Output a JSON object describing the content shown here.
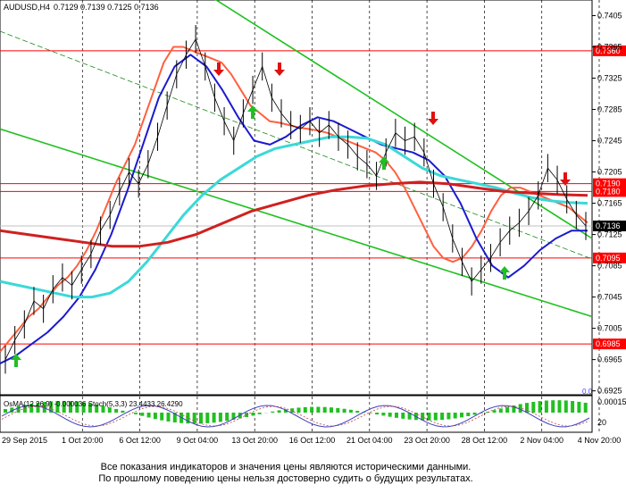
{
  "header": {
    "symbol": "AUDUSD,H4",
    "ohlc": "0.7129 0.7139 0.7125 0.7136"
  },
  "footer": {
    "line1": "Все показания индикаторов и значения цены являются историческими данными.",
    "line2": "По прошлому поведению цены нельзя достоверно судить о будущих результатах."
  },
  "chart_data": {
    "type": "line",
    "symbol": "AUDUSD",
    "timeframe": "H4",
    "ylim": [
      0.692,
      0.7425
    ],
    "y_ticks": [
      "0.7405",
      "0.7365",
      "0.7325",
      "0.7285",
      "0.7245",
      "0.7205",
      "0.7165",
      "0.7125",
      "0.7085",
      "0.7045",
      "0.7005",
      "0.6965",
      "0.6925"
    ],
    "x_ticks": [
      "29 Sep 2015",
      "1 Oct 20:00",
      "6 Oct 12:00",
      "9 Oct 04:00",
      "13 Oct 20:00",
      "16 Oct 12:00",
      "21 Oct 04:00",
      "23 Oct 20:00",
      "28 Oct 12:00",
      "2 Nov 04:00",
      "4 Nov 20:00"
    ],
    "levels": [
      {
        "label": "0.7360",
        "value": 0.736,
        "color": "#ff0000"
      },
      {
        "label": "0.7190",
        "value": 0.719,
        "color": "#ff0000"
      },
      {
        "label": "0.7180",
        "value": 0.718,
        "color": "#ff0000"
      },
      {
        "label": "0.7095",
        "value": 0.7095,
        "color": "#ff0000"
      },
      {
        "label": "0.6985",
        "value": 0.6985,
        "color": "#ff0000"
      }
    ],
    "current_price": {
      "label": "0.7136",
      "value": 0.7136
    },
    "price_series": [
      0.6965,
      0.699,
      0.701,
      0.704,
      0.703,
      0.7055,
      0.707,
      0.706,
      0.708,
      0.71,
      0.713,
      0.715,
      0.718,
      0.7205,
      0.719,
      0.7215,
      0.725,
      0.729,
      0.733,
      0.7355,
      0.7375,
      0.734,
      0.73,
      0.727,
      0.7245,
      0.728,
      0.731,
      0.734,
      0.73,
      0.728,
      0.7265,
      0.726,
      0.727,
      0.7255,
      0.7265,
      0.725,
      0.724,
      0.7225,
      0.7215,
      0.72,
      0.723,
      0.7255,
      0.7245,
      0.725,
      0.723,
      0.719,
      0.716,
      0.712,
      0.709,
      0.7065,
      0.708,
      0.7095,
      0.7115,
      0.713,
      0.714,
      0.7155,
      0.7175,
      0.721,
      0.7195,
      0.717,
      0.715,
      0.7136
    ],
    "series": [
      {
        "color": "#ff6040",
        "values": [
          0.6975,
          0.699,
          0.7005,
          0.702,
          0.703,
          0.7045,
          0.706,
          0.707,
          0.7085,
          0.7105,
          0.713,
          0.716,
          0.719,
          0.7215,
          0.724,
          0.7275,
          0.731,
          0.7345,
          0.7365,
          0.7365,
          0.736,
          0.7355,
          0.735,
          0.7345,
          0.733,
          0.731,
          0.729,
          0.728,
          0.727,
          0.7268,
          0.7265,
          0.7262,
          0.726,
          0.7258,
          0.7255,
          0.725,
          0.7245,
          0.724,
          0.7235,
          0.723,
          0.722,
          0.7205,
          0.7185,
          0.716,
          0.7135,
          0.711,
          0.7095,
          0.709,
          0.7095,
          0.711,
          0.713,
          0.7155,
          0.7175,
          0.7185,
          0.7185,
          0.718,
          0.7175,
          0.717,
          0.7165,
          0.716,
          0.715,
          0.714
        ]
      },
      {
        "color": "#1a1ad0",
        "values": [
          0.696,
          0.697,
          0.6985,
          0.7,
          0.702,
          0.7045,
          0.708,
          0.7125,
          0.718,
          0.724,
          0.73,
          0.734,
          0.7355,
          0.734,
          0.731,
          0.7275,
          0.7245,
          0.724,
          0.725,
          0.7265,
          0.7275,
          0.727,
          0.726,
          0.725,
          0.724,
          0.7235,
          0.723,
          0.722,
          0.72,
          0.7165,
          0.712,
          0.7085,
          0.707,
          0.7085,
          0.7105,
          0.712,
          0.713,
          0.713
        ]
      },
      {
        "color": "#3cd8d8",
        "values": [
          0.7065,
          0.706,
          0.7055,
          0.705,
          0.7045,
          0.7045,
          0.705,
          0.7065,
          0.709,
          0.712,
          0.715,
          0.7175,
          0.7195,
          0.721,
          0.7225,
          0.7235,
          0.724,
          0.7245,
          0.725,
          0.725,
          0.7248,
          0.724,
          0.7225,
          0.721,
          0.72,
          0.7195,
          0.719,
          0.7185,
          0.7178,
          0.7172,
          0.7168,
          0.7166,
          0.7165
        ]
      },
      {
        "color": "#d02020",
        "values": [
          0.713,
          0.7125,
          0.712,
          0.7115,
          0.711,
          0.711,
          0.7115,
          0.7125,
          0.714,
          0.7155,
          0.7165,
          0.7175,
          0.7182,
          0.7187,
          0.719,
          0.7192,
          0.719,
          0.7185,
          0.718,
          0.7178,
          0.7176,
          0.7175
        ]
      },
      {
        "color": "#20c020",
        "values": [
          0.747,
          0.712
        ]
      },
      {
        "color": "#20c020",
        "values": [
          0.726,
          0.702
        ]
      }
    ],
    "oscillator": {
      "label": "OsMA(12,26,9) -0.000036   Stoch(5,3,3) 23.4433  26.4290",
      "y_ticks": [
        "0.000153",
        "20"
      ],
      "bottom_label": "0.0"
    }
  }
}
